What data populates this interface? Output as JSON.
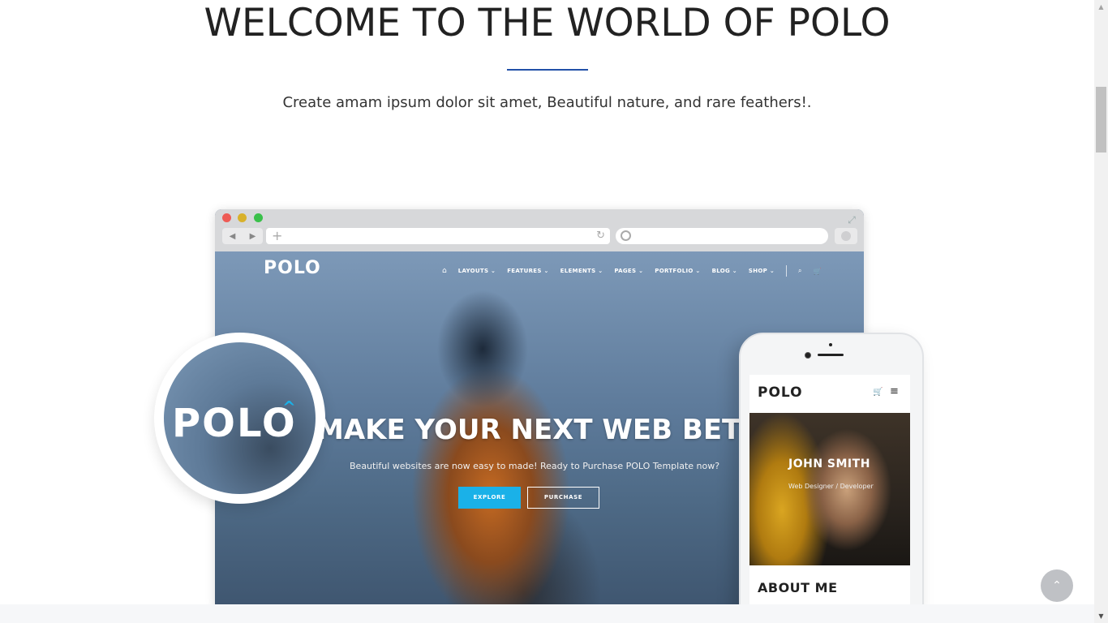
{
  "hero": {
    "title": "WELCOME TO THE WORLD OF POLO",
    "subtitle": "Create amam ipsum dolor sit amet, Beautiful nature, and rare feathers!."
  },
  "browser_mockup": {
    "nav_back_icon": "◀",
    "nav_forward_icon": "▶",
    "url_plus_icon": "+",
    "reload_icon": "↻",
    "expand_icon": "⤢",
    "site": {
      "logo": "POLO",
      "nav_items": [
        "LAYOUTS ⌄",
        "FEATURES ⌄",
        "ELEMENTS ⌄",
        "PAGES ⌄",
        "PORTFOLIO ⌄",
        "BLOG ⌄",
        "SHOP ⌄"
      ],
      "home_icon": "⌂",
      "search_icon": "⌕",
      "cart_icon": "🛒",
      "headline": "MAKE YOUR NEXT WEB BETTER",
      "tagline": "Beautiful websites are now easy to made! Ready to Purchase POLO Template now?",
      "explore_label": "EXPLORE",
      "purchase_label": "PURCHASE"
    }
  },
  "badge": {
    "logo": "POLO"
  },
  "phone_mockup": {
    "logo": "POLO",
    "cart_icon": "🛒",
    "menu_icon": "≡",
    "name": "JOHN SMITH",
    "role": "Web Designer / Developer",
    "section_title": "ABOUT ME"
  },
  "back_to_top": {
    "icon": "⌃"
  },
  "scrollbar": {
    "up_icon": "▲",
    "down_icon": "▼"
  },
  "colors": {
    "accent": "#1ab1e8",
    "title_rule": "#2250a8",
    "title_text": "#222222"
  }
}
